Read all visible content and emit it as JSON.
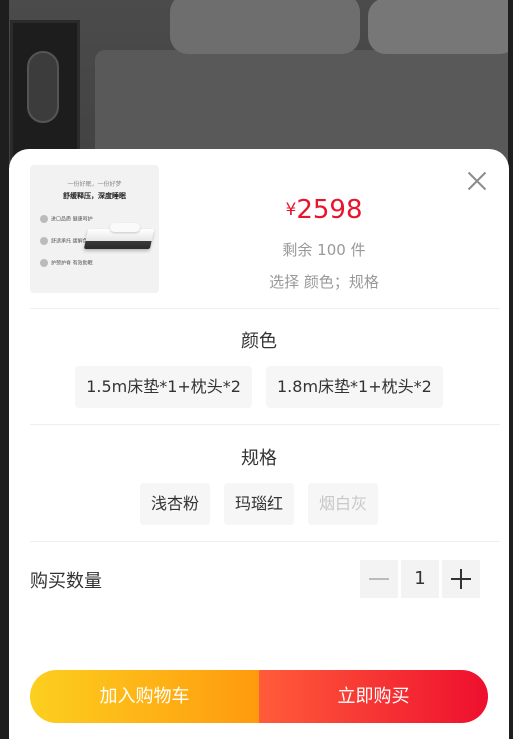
{
  "product": {
    "thumb_line1": "一份好眠，一份好梦",
    "thumb_line2": "舒缓释压，深度睡眠",
    "thumb_features": [
      "进口品质 健康呵护",
      "舒适承托 缓解负担",
      "护颈护脊 有效助眠"
    ],
    "currency": "¥",
    "price": "2598",
    "stock": "剩余 100 件",
    "selected_hint": "选择 颜色；规格"
  },
  "color_section": {
    "title": "颜色",
    "options": [
      "1.5m床垫*1+枕头*2",
      "1.8m床垫*1+枕头*2"
    ]
  },
  "spec_section": {
    "title": "规格",
    "options": [
      "浅杏粉",
      "玛瑙红",
      "烟白灰"
    ],
    "disabled": [
      false,
      false,
      true
    ]
  },
  "quantity": {
    "label": "购买数量",
    "value": "1"
  },
  "actions": {
    "add_to_cart": "加入购物车",
    "buy_now": "立即购买"
  },
  "colors": {
    "price": "#e8142d",
    "cart_gradient": [
      "#fccf1f",
      "#ff9a0e"
    ],
    "buy_gradient": [
      "#ff5c3a",
      "#ee0f2e"
    ]
  },
  "icons": [
    "close-icon",
    "minus-icon",
    "plus-icon"
  ]
}
